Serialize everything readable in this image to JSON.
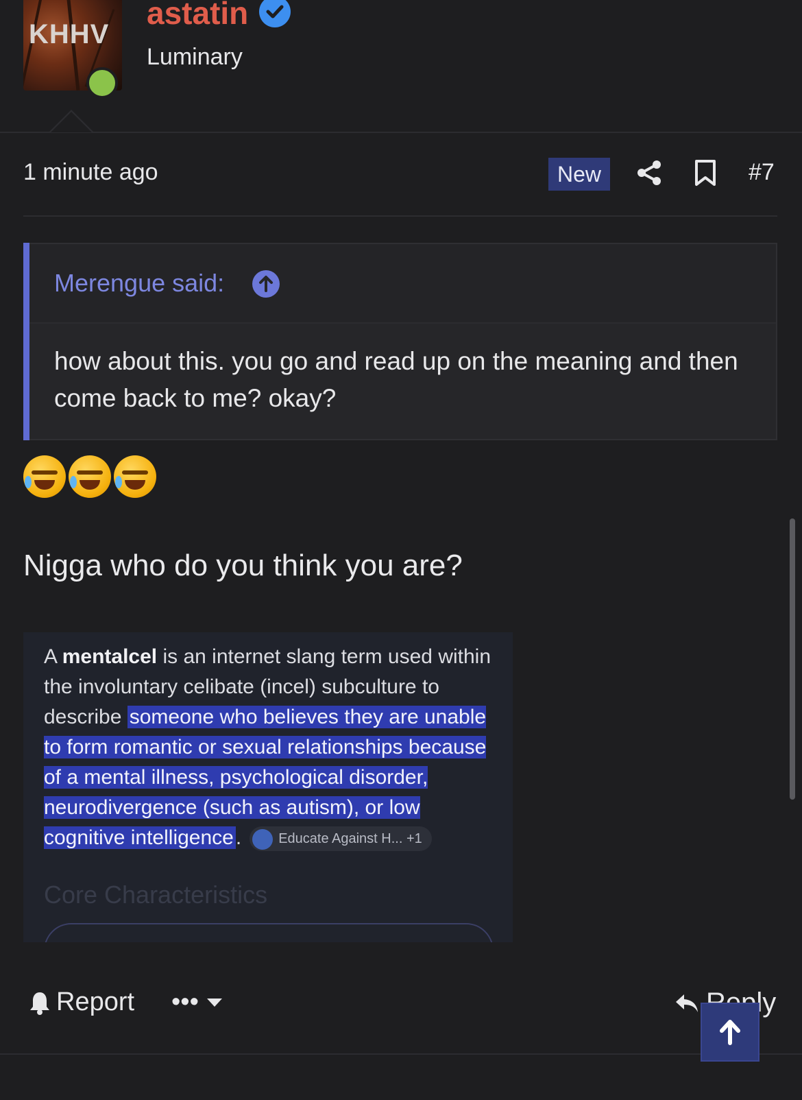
{
  "author": {
    "avatar_text": "KHHV",
    "username": "astatin",
    "user_title": "Luminary",
    "verified_icon": "verified-check-icon",
    "online_status": "online",
    "online_color": "#8bc34a",
    "username_color": "#e05d4b"
  },
  "post_meta": {
    "time": "1 minute ago",
    "new_badge": "New",
    "share_icon": "share-icon",
    "bookmark_icon": "bookmark-icon",
    "post_number": "#7"
  },
  "quote": {
    "author_label": "Merengue said:",
    "jump_icon": "arrow-up-circle-icon",
    "text": "how about this. you go and read up on the meaning and then come back to me? okay?",
    "accent_color": "#5f6bd2"
  },
  "emojis": [
    "rolling-on-floor-laughing",
    "rolling-on-floor-laughing",
    "rolling-on-floor-laughing"
  ],
  "message": "Nigga who do you think you are?",
  "embedded_screenshot": {
    "lead_a": "A ",
    "term": "mentalcel",
    "lead_b": " is an internet slang term used within the involuntary celibate (incel) subculture to describe ",
    "highlighted": "someone who believes they are unable to form romantic or sexual relationships because of a mental illness, psychological disorder, neurodivergence (such as autism), or low cognitive intelligence",
    "tail": ".",
    "source_chip": "Educate Against H...",
    "source_more": "+1",
    "section_heading": "Core Characteristics",
    "highlight_color": "#2f3cb0"
  },
  "actions": {
    "report_label": "Report",
    "more_label": "•••",
    "reply_label": "Reply",
    "scroll_top_icon": "arrow-up-icon"
  }
}
